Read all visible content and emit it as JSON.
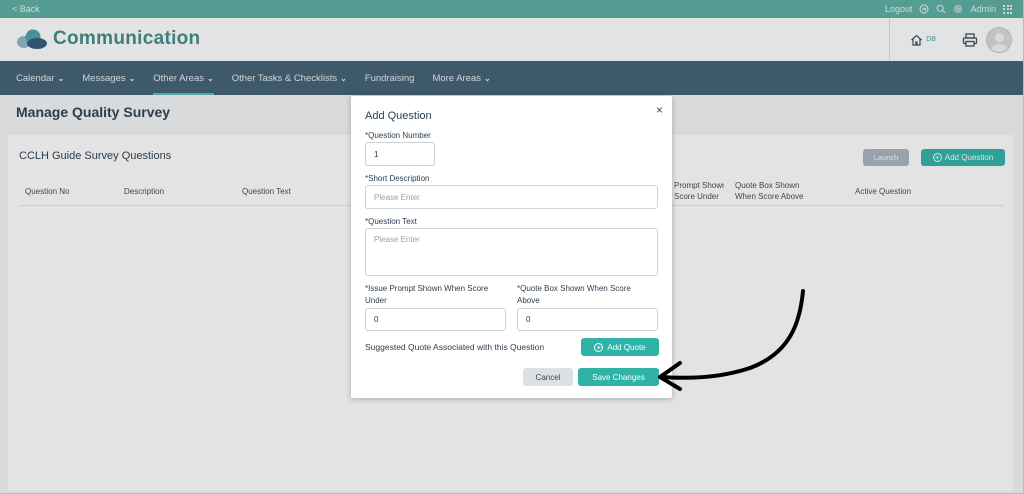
{
  "topbar": {
    "back": "< Back",
    "logout": "Logout",
    "admin": "Admin"
  },
  "header": {
    "brand": "Communication",
    "home_badge": "DB"
  },
  "nav": {
    "items": [
      {
        "label": "Calendar",
        "chevron": true
      },
      {
        "label": "Messages",
        "chevron": true
      },
      {
        "label": "Other Areas",
        "chevron": true,
        "active": true
      },
      {
        "label": "Other Tasks & Checklists",
        "chevron": true
      },
      {
        "label": "Fundraising",
        "chevron": false
      },
      {
        "label": "More Areas",
        "chevron": true
      }
    ]
  },
  "page": {
    "title": "Manage Quality Survey",
    "card_title": "CCLH Guide Survey Questions",
    "launch": "Launch",
    "add_question": "Add Question",
    "columns": [
      "Question No",
      "Description",
      "Question Text",
      "Prompt Shown\nScore Under",
      "Quote Box Shown\nWhen Score Above",
      "Active Question"
    ]
  },
  "modal": {
    "title": "Add Question",
    "close": "×",
    "question_number": {
      "label": "*Question Number",
      "value": "1"
    },
    "short_description": {
      "label": "*Short Description",
      "placeholder": "Please Enter"
    },
    "question_text": {
      "label": "*Question Text",
      "placeholder": "Please Enter"
    },
    "issue_prompt": {
      "label": "*Issue Prompt Shown When Score Under",
      "value": "0"
    },
    "quote_box": {
      "label": "*Quote Box Shown When Score Above",
      "value": "0"
    },
    "suggested_quote_label": "Suggested Quote Associated with this Question",
    "add_quote": "Add Quote",
    "cancel": "Cancel",
    "save": "Save Changes"
  },
  "colors": {
    "teal": "#2fb3a7",
    "nav": "#3f5f72",
    "topbar": "#5aaea2",
    "brand": "#3d8b87"
  },
  "icons": [
    "logout-icon",
    "search-icon",
    "gear-icon",
    "apps-grid-icon",
    "home-icon",
    "printer-icon",
    "avatar",
    "close-icon",
    "plus-circle-icon",
    "chevron-down-icon",
    "annotation-arrow"
  ]
}
